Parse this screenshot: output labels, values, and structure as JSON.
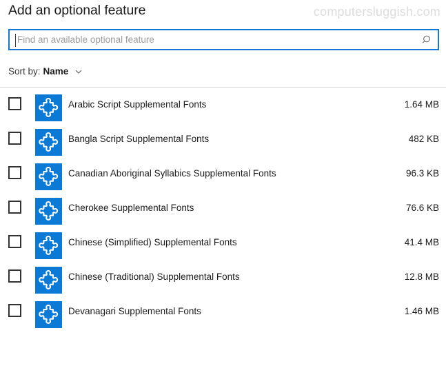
{
  "header": {
    "title": "Add an optional feature",
    "watermark": "computersluggish.com"
  },
  "search": {
    "placeholder": "Find an available optional feature",
    "value": "",
    "icon": "search-icon"
  },
  "sort": {
    "label": "Sort by:",
    "value": "Name",
    "chevron_icon": "chevron-down-icon"
  },
  "colors": {
    "accent": "#1477d4",
    "icon_tile": "#0a7ad6",
    "text": "#1b1b1b",
    "muted_text": "#9b9b9b",
    "watermark": "#dcdcdc",
    "divider": "#d4d4d4",
    "checkbox_border": "#333333"
  },
  "list": {
    "item_icon": "puzzle-piece-icon",
    "items": [
      {
        "name": "Arabic Script Supplemental Fonts",
        "size": "1.64 MB",
        "checked": false
      },
      {
        "name": "Bangla Script Supplemental Fonts",
        "size": "482 KB",
        "checked": false
      },
      {
        "name": "Canadian Aboriginal Syllabics Supplemental Fonts",
        "size": "96.3 KB",
        "checked": false
      },
      {
        "name": "Cherokee Supplemental Fonts",
        "size": "76.6 KB",
        "checked": false
      },
      {
        "name": "Chinese (Simplified) Supplemental Fonts",
        "size": "41.4 MB",
        "checked": false
      },
      {
        "name": "Chinese (Traditional) Supplemental Fonts",
        "size": "12.8 MB",
        "checked": false
      },
      {
        "name": "Devanagari Supplemental Fonts",
        "size": "1.46 MB",
        "checked": false
      }
    ]
  }
}
